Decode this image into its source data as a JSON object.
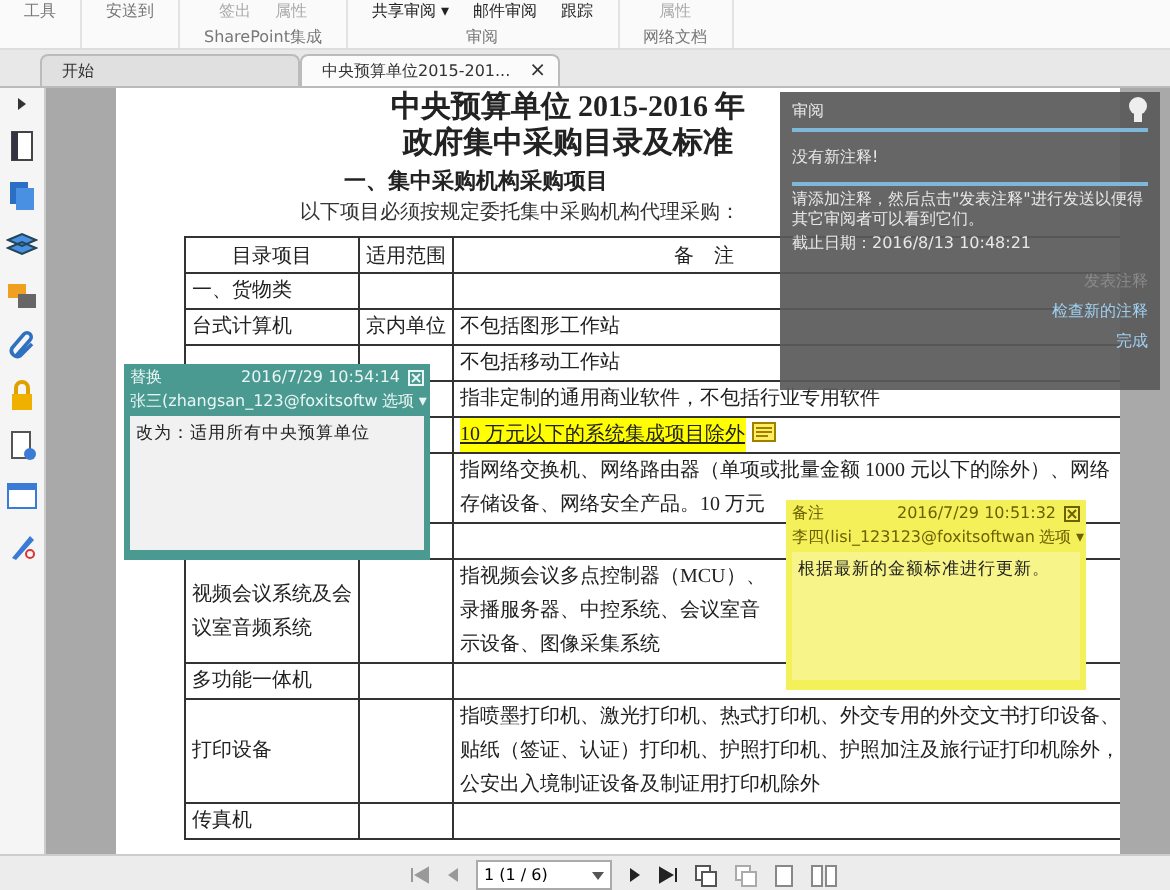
{
  "ribbon": {
    "groups": [
      {
        "label": "工具"
      },
      {
        "label": "安送到"
      },
      {
        "buttons": [
          {
            "label": "签出",
            "disabled": true
          },
          {
            "label": "属性",
            "disabled": true
          }
        ],
        "label": "SharePoint集成"
      },
      {
        "buttons": [
          {
            "label": "共享审阅 ▾",
            "disabled": false
          },
          {
            "label": "邮件审阅",
            "disabled": false
          },
          {
            "label": "跟踪",
            "disabled": false
          }
        ],
        "label": "审阅"
      },
      {
        "buttons": [
          {
            "label": "属性",
            "disabled": true
          }
        ],
        "label": "网络文档"
      }
    ]
  },
  "tabs": [
    {
      "label": "开始",
      "selected": false
    },
    {
      "label": "中央预算单位2015-201...",
      "selected": true,
      "close": "×"
    }
  ],
  "document": {
    "title_lines": [
      "中央预算单位 2015-2016 年",
      "政府集中采购目录及标准"
    ],
    "heading": "一、集中采购机构采购项目",
    "intro": "以下项目必须按规定委托集中采购机构代理采购：",
    "table": {
      "columns": [
        "目录项目",
        "适用范围",
        "备　注"
      ],
      "rows": [
        {
          "cells": [
            [
              "一、货物类"
            ],
            [],
            []
          ]
        },
        {
          "cells": [
            [
              "台式计算机"
            ],
            [
              "京内单位"
            ],
            [
              "不包括图形工作站"
            ]
          ]
        },
        {
          "cells": [
            [],
            [],
            [
              "不包括移动工作站"
            ]
          ]
        },
        {
          "cells": [
            [],
            [],
            [
              "指非定制的通用商业软件，不包括行业专用软件"
            ]
          ]
        },
        {
          "cells": [
            [],
            [],
            [
              "10 万元以下的系统集成项目除外"
            ]
          ],
          "highlighted": true
        },
        {
          "cells": [
            [],
            [],
            [
              "指网络交换机、网络路由器（单项或批量金额 1000 元以下的除外）、网络",
              "存储设备、网络安全产品。10 万元"
            ]
          ]
        },
        {
          "kind": "blank"
        },
        {
          "cells": [
            [
              "视频会议系统及会",
              "议室音频系统"
            ],
            [],
            [
              "指视频会议多点控制器（MCU）、",
              "录播服务器、中控系统、会议室音",
              "示设备、图像采集系统"
            ]
          ]
        },
        {
          "cells": [
            [
              "多功能一体机"
            ],
            [],
            []
          ]
        },
        {
          "cells": [
            [
              "打印设备"
            ],
            [],
            [
              "指喷墨打印机、激光打印机、热式打印机、外交专用的外交文书打印设备、",
              "贴纸（签证、认证）打印机、护照打印机、护照加注及旅行证打印机除外，",
              "公安出入境制证设备及制证用打印机除外"
            ]
          ]
        },
        {
          "cells": [
            [
              "传真机"
            ],
            [],
            []
          ]
        }
      ]
    }
  },
  "comments": [
    {
      "kind": "replace",
      "type": "替换",
      "date": "2016/7/29 10:54:14",
      "author": "张三(zhangsan_123@foxitsoftw",
      "options": "选项 ▾",
      "text": "改为：适用所有中央预算单位"
    },
    {
      "kind": "note",
      "type": "备注",
      "date": "2016/7/29 10:51:32",
      "author": "李四(lisi_123123@foxitsoftwan",
      "options": "选项 ▾",
      "text": "根据最新的金额标准进行更新。"
    }
  ],
  "review_panel": {
    "title": "审阅",
    "status": "没有新注释!",
    "message": "请添加注释，然后点击\"发表注释\"进行发送以便得其它审阅者可以看到它们。",
    "deadline": "截止日期：2016/8/13 10:48:21",
    "links": [
      {
        "label": "发表注释",
        "disabled": true
      },
      {
        "label": "检查新的注释",
        "disabled": false
      },
      {
        "label": "完成",
        "disabled": false
      }
    ]
  },
  "statusbar": {
    "page": "1 (1 / 6)"
  }
}
